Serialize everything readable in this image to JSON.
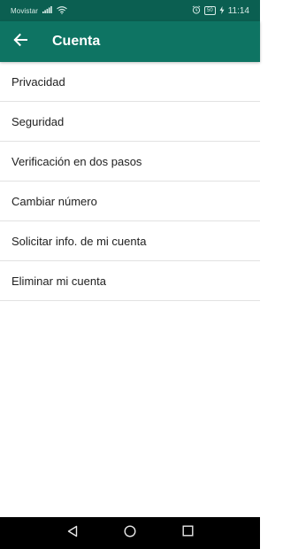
{
  "status_bar": {
    "carrier": "Movistar",
    "battery": "50",
    "time": "11:14"
  },
  "app_bar": {
    "title": "Cuenta"
  },
  "menu": {
    "items": [
      {
        "label": "Privacidad"
      },
      {
        "label": "Seguridad"
      },
      {
        "label": "Verificación en dos pasos"
      },
      {
        "label": "Cambiar número"
      },
      {
        "label": "Solicitar info. de mi cuenta"
      },
      {
        "label": "Eliminar mi cuenta"
      }
    ]
  },
  "colors": {
    "status_bar": "#0b5f51",
    "app_bar": "#0e7463",
    "divider": "#e2e2e2",
    "nav_bar": "#000000"
  },
  "icons": {
    "back": "arrow-back-icon",
    "signal": "signal-icon",
    "wifi": "wifi-icon",
    "alarm": "alarm-icon",
    "battery": "battery-icon",
    "charging": "charging-icon",
    "nav_back": "nav-back-icon",
    "nav_home": "nav-home-icon",
    "nav_recents": "nav-recents-icon"
  }
}
